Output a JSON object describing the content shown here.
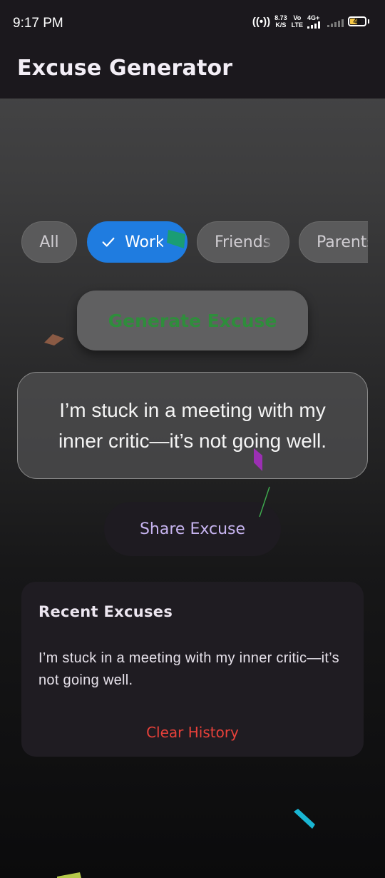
{
  "status_bar": {
    "time": "9:17 PM",
    "speed_value": "8.73",
    "speed_unit": "K/S",
    "volte_top": "Vo",
    "volte_bottom": "LTE",
    "network": "4G+",
    "battery_level": "45",
    "battery_percent": 45,
    "icons": [
      "hotspot-icon",
      "signal-icon",
      "battery-icon"
    ]
  },
  "app_bar": {
    "title": "Excuse Generator"
  },
  "categories": {
    "chips": [
      {
        "label": "All",
        "selected": false
      },
      {
        "label": "Work",
        "selected": true
      },
      {
        "label": "Friends",
        "selected": false
      },
      {
        "label": "Parents",
        "selected": false
      }
    ]
  },
  "generate": {
    "label": "Generate Excuse"
  },
  "excuse": {
    "text": "I’m stuck in a meeting with my inner critic—it’s not going well."
  },
  "share": {
    "label": "Share Excuse"
  },
  "recent": {
    "title": "Recent Excuses",
    "items": [
      "I’m stuck in a meeting with my inner critic—it’s not going well."
    ],
    "clear_label": "Clear History"
  },
  "colors": {
    "accent_blue": "#1f7ce0",
    "generate_text": "#2f8d3c",
    "share_text": "#c7b4f0",
    "clear_text": "#e8413a",
    "app_bar_bg": "#1b181d"
  }
}
